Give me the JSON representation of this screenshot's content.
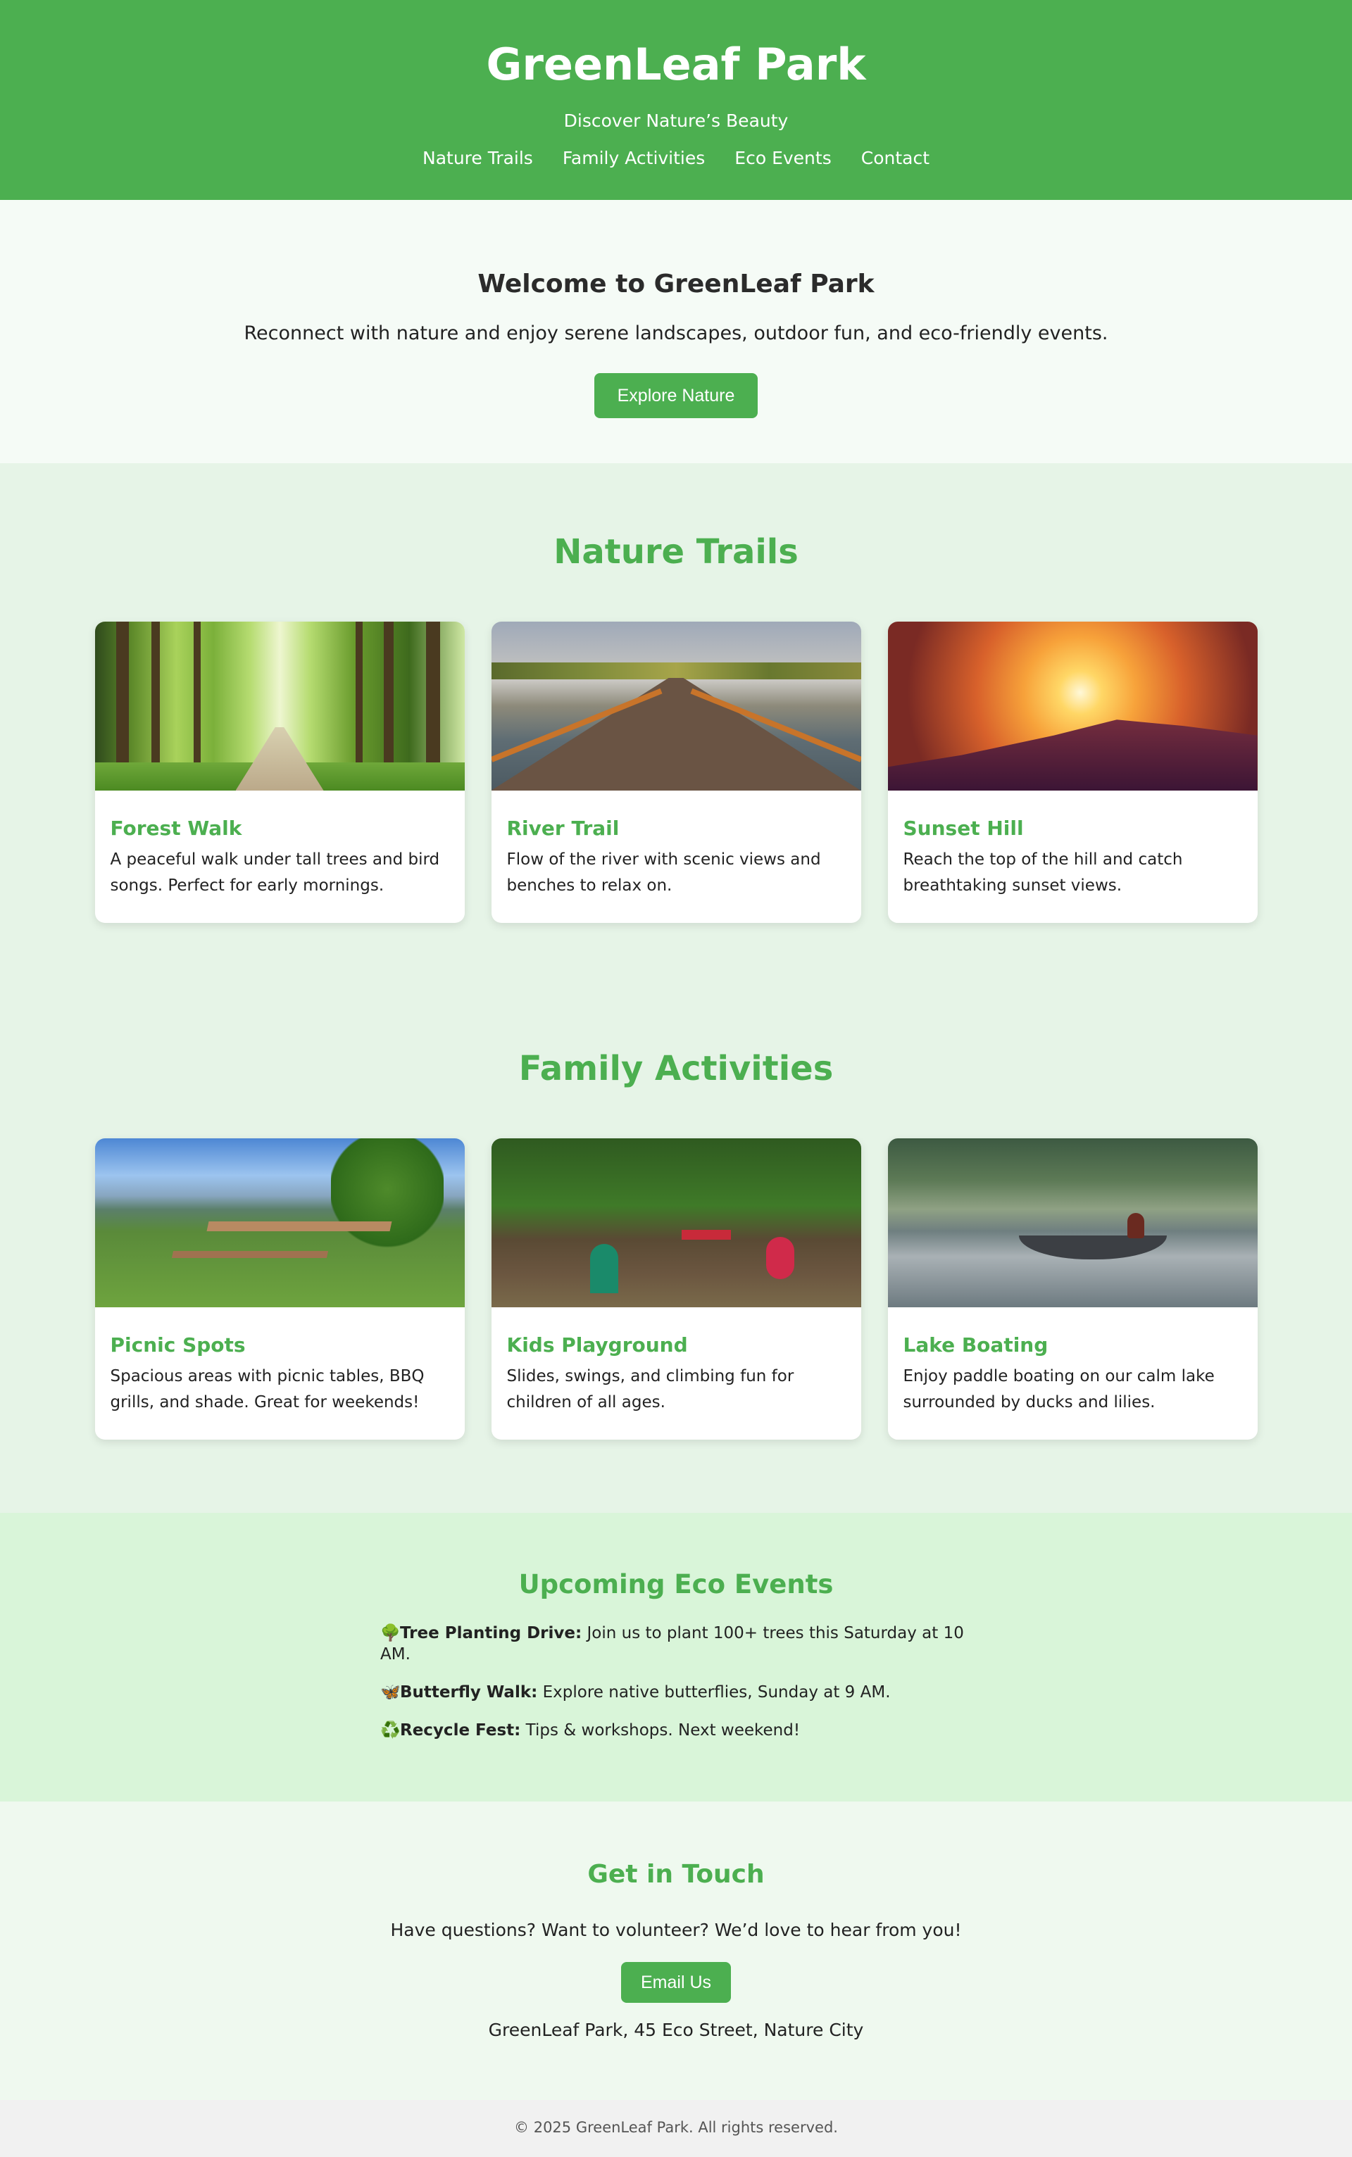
{
  "header": {
    "title": "GreenLeaf Park",
    "tagline": "Discover Nature’s Beauty",
    "nav": [
      "Nature Trails",
      "Family Activities",
      "Eco Events",
      "Contact"
    ]
  },
  "welcome": {
    "title": "Welcome to GreenLeaf Park",
    "text": "Reconnect with nature and enjoy serene landscapes, outdoor fun, and eco-friendly events.",
    "button": "Explore Nature"
  },
  "trails": {
    "title": "Nature Trails",
    "cards": [
      {
        "title": "Forest Walk",
        "text": "A peaceful walk under tall trees and bird songs. Perfect for early mornings."
      },
      {
        "title": "River Trail",
        "text": "Flow of the river with scenic views and benches to relax on."
      },
      {
        "title": "Sunset Hill",
        "text": "Reach the top of the hill and catch breathtaking sunset views."
      }
    ]
  },
  "family": {
    "title": "Family Activities",
    "cards": [
      {
        "title": "Picnic Spots",
        "text": "Spacious areas with picnic tables, BBQ grills, and shade. Great for weekends!"
      },
      {
        "title": "Kids Playground",
        "text": "Slides, swings, and climbing fun for children of all ages."
      },
      {
        "title": "Lake Boating",
        "text": "Enjoy paddle boating on our calm lake surrounded by ducks and lilies."
      }
    ]
  },
  "events": {
    "title": "Upcoming Eco Events",
    "items": [
      {
        "icon": "🌳",
        "name": "Tree Planting Drive:",
        "text": " Join us to plant 100+ trees this Saturday at 10 AM."
      },
      {
        "icon": "🦋",
        "name": "Butterfly Walk:",
        "text": " Explore native butterflies, Sunday at 9 AM."
      },
      {
        "icon": "♻️",
        "name": "Recycle Fest:",
        "text": " Tips & workshops. Next weekend!"
      }
    ]
  },
  "contact": {
    "title": "Get in Touch",
    "text": "Have questions? Want to volunteer? We’d love to hear from you!",
    "button": "Email Us",
    "address": "GreenLeaf Park, 45 Eco Street, Nature City"
  },
  "footer": {
    "text": "© 2025 GreenLeaf Park. All rights reserved."
  },
  "colors": {
    "brand": "#4caf50"
  }
}
